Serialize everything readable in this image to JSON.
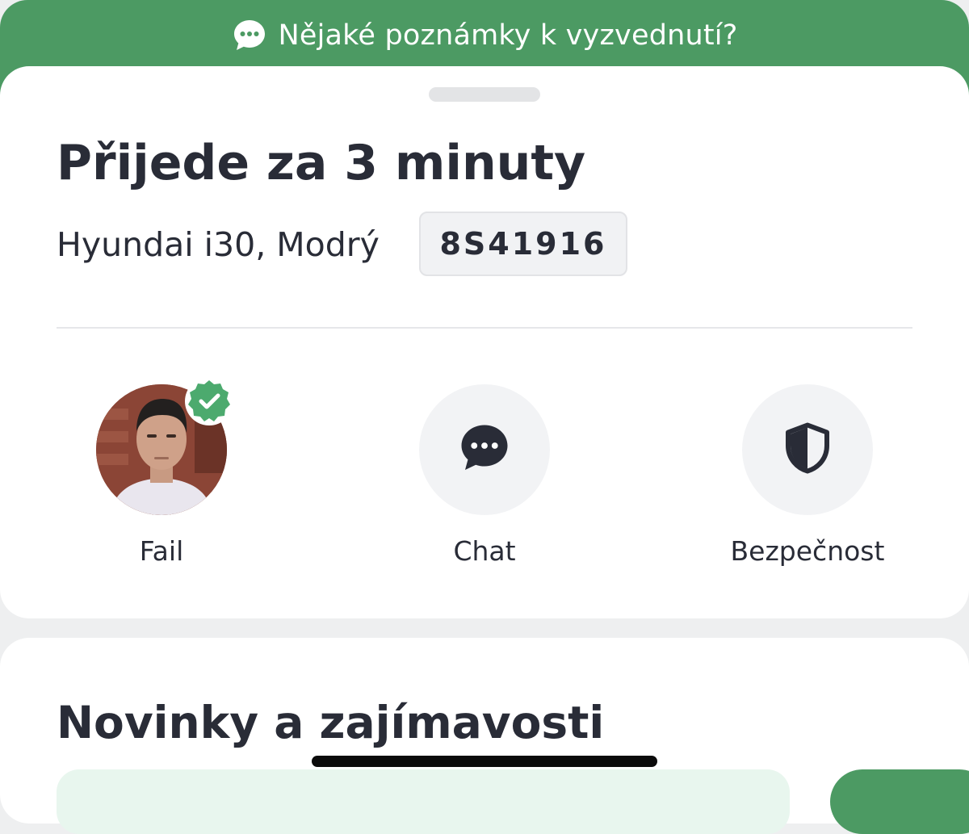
{
  "banner": {
    "text": "Nějaké poznámky k vyzvednutí?",
    "icon": "chat-bubble-icon",
    "background": "#4c9a63"
  },
  "ride": {
    "eta_title": "Přijede za 3 minuty",
    "car": "Hyundai i30, Modrý",
    "plate": "8S41916"
  },
  "actions": [
    {
      "label": "Fail",
      "icon": "driver-avatar",
      "badge": "verified-check-icon"
    },
    {
      "label": "Chat",
      "icon": "chat-bubble-icon"
    },
    {
      "label": "Bezpečnost",
      "icon": "shield-icon"
    }
  ],
  "news": {
    "title": "Novinky a zajímavosti"
  },
  "colors": {
    "brand_green": "#4c9a63",
    "text_dark": "#292c37",
    "surface_light": "#f2f3f5"
  }
}
